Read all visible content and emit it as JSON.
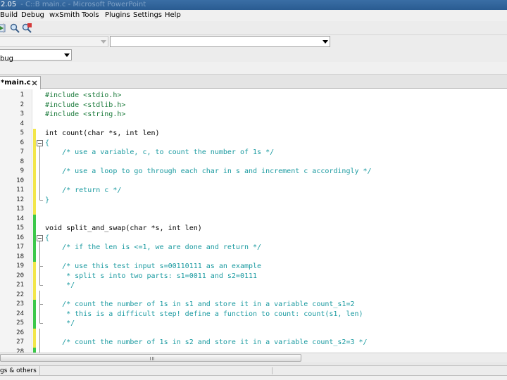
{
  "window": {
    "title": "2.05",
    "title_faded": "- C::B main.c - Microsoft PowerPoint"
  },
  "menubar": {
    "items": [
      "Build",
      "Debug",
      "wxSmith",
      "Tools",
      "Plugins",
      "Settings",
      "Help"
    ]
  },
  "toolbar": {
    "icons": [
      "run-icon",
      "find-icon",
      "find-replace-icon"
    ]
  },
  "combos": {
    "scope_value": "",
    "function_value": "",
    "build_target_value": "bug"
  },
  "editor": {
    "tab_label": "*main.c",
    "lines": [
      {
        "n": "1",
        "text": "#include <stdio.h>",
        "color": "#1a7a3a",
        "bar": "none",
        "fold": ""
      },
      {
        "n": "2",
        "text": "#include <stdlib.h>",
        "color": "#1a7a3a",
        "bar": "none",
        "fold": ""
      },
      {
        "n": "3",
        "text": "#include <string.h>",
        "color": "#1a7a3a",
        "bar": "none",
        "fold": ""
      },
      {
        "n": "4",
        "text": "",
        "color": "#000000",
        "bar": "none",
        "fold": ""
      },
      {
        "n": "5",
        "text": "int count(char *s, int len)",
        "color": "#000000",
        "bar": "yellow",
        "fold": ""
      },
      {
        "n": "6",
        "text": "{",
        "color": "#1a9aa0",
        "bar": "yellow",
        "fold": "box"
      },
      {
        "n": "7",
        "text": "    /* use a variable, c, to count the number of 1s */",
        "color": "#1a9aa0",
        "bar": "yellow",
        "fold": "line"
      },
      {
        "n": "8",
        "text": "",
        "color": "#000000",
        "bar": "yellow",
        "fold": "line"
      },
      {
        "n": "9",
        "text": "    /* use a loop to go through each char in s and increment c accordingly */",
        "color": "#1a9aa0",
        "bar": "yellow",
        "fold": "line"
      },
      {
        "n": "10",
        "text": "",
        "color": "#000000",
        "bar": "yellow",
        "fold": "line"
      },
      {
        "n": "11",
        "text": "    /* return c */",
        "color": "#1a9aa0",
        "bar": "yellow",
        "fold": "line"
      },
      {
        "n": "12",
        "text": "}",
        "color": "#1a9aa0",
        "bar": "yellow",
        "fold": "end"
      },
      {
        "n": "13",
        "text": "",
        "color": "#000000",
        "bar": "yellow",
        "fold": ""
      },
      {
        "n": "14",
        "text": "",
        "color": "#000000",
        "bar": "green",
        "fold": ""
      },
      {
        "n": "15",
        "text": "void split_and_swap(char *s, int len)",
        "color": "#000000",
        "bar": "green",
        "fold": ""
      },
      {
        "n": "16",
        "text": "{",
        "color": "#1a9aa0",
        "bar": "green",
        "fold": "box"
      },
      {
        "n": "17",
        "text": "    /* if the len is <=1, we are done and return */",
        "color": "#1a9aa0",
        "bar": "green",
        "fold": "line"
      },
      {
        "n": "18",
        "text": "",
        "color": "#000000",
        "bar": "green",
        "fold": "line"
      },
      {
        "n": "19",
        "text": "    /* use this test input s=00110111 as an example",
        "color": "#1a9aa0",
        "bar": "yellow",
        "fold": "branch"
      },
      {
        "n": "20",
        "text": "     * split s into two parts: s1=0011 and s2=0111",
        "color": "#1a9aa0",
        "bar": "yellow",
        "fold": "line"
      },
      {
        "n": "21",
        "text": "     */",
        "color": "#1a9aa0",
        "bar": "yellow",
        "fold": "end"
      },
      {
        "n": "22",
        "text": "",
        "color": "#000000",
        "bar": "yellow",
        "fold": "line"
      },
      {
        "n": "23",
        "text": "    /* count the number of 1s in s1 and store it in a variable count_s1=2",
        "color": "#1a9aa0",
        "bar": "green",
        "fold": "branch"
      },
      {
        "n": "24",
        "text": "     * this is a difficult step! define a function to count: count(s1, len)",
        "color": "#1a9aa0",
        "bar": "green",
        "fold": "line"
      },
      {
        "n": "25",
        "text": "     */",
        "color": "#1a9aa0",
        "bar": "green",
        "fold": "end"
      },
      {
        "n": "26",
        "text": "",
        "color": "#000000",
        "bar": "yellow",
        "fold": "line"
      },
      {
        "n": "27",
        "text": "    /* count the number of 1s in s2 and store it in a variable count_s2=3 */",
        "color": "#1a9aa0",
        "bar": "yellow",
        "fold": "line"
      },
      {
        "n": "28",
        "text": "",
        "color": "#000000",
        "bar": "green",
        "fold": "line"
      }
    ]
  },
  "bottom_panel": {
    "tab_label": "gs & others"
  },
  "colors": {
    "change_yellow": "#f2e64a",
    "change_green": "#3cc84a",
    "comment": "#1a9aa0",
    "preprocessor": "#1a7a3a"
  }
}
